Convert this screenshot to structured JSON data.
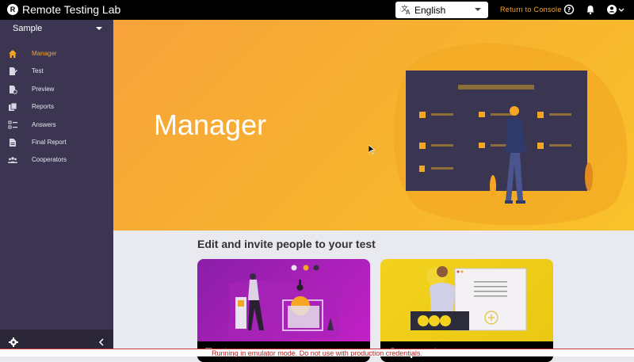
{
  "app": {
    "title": "Remote Testing Lab",
    "logo_letter": "R"
  },
  "header": {
    "language": "English",
    "return_link": "Return to Console",
    "icons": [
      "help-icon",
      "notifications-icon",
      "account-icon"
    ]
  },
  "sidebar": {
    "project": "Sample",
    "items": [
      {
        "label": "Manager",
        "icon": "home-icon",
        "active": true
      },
      {
        "label": "Test",
        "icon": "edit-document-icon",
        "active": false
      },
      {
        "label": "Preview",
        "icon": "preview-document-icon",
        "active": false
      },
      {
        "label": "Reports",
        "icon": "reports-icon",
        "active": false
      },
      {
        "label": "Answers",
        "icon": "checklist-icon",
        "active": false
      },
      {
        "label": "Final Report",
        "icon": "document-icon",
        "active": false
      },
      {
        "label": "Cooperators",
        "icon": "group-icon",
        "active": false
      }
    ],
    "footer_icons": [
      "settings-icon",
      "collapse-icon"
    ]
  },
  "hero": {
    "title": "Manager"
  },
  "main": {
    "heading": "Edit and invite people to your test",
    "cards": [
      {
        "title": "Test"
      },
      {
        "title": "Cooperators"
      }
    ]
  },
  "notice": "Running in emulator mode. Do not use with production credentials.",
  "colors": {
    "accent": "#f5a623",
    "sidebar": "#3b3552",
    "topbar": "#000000"
  }
}
